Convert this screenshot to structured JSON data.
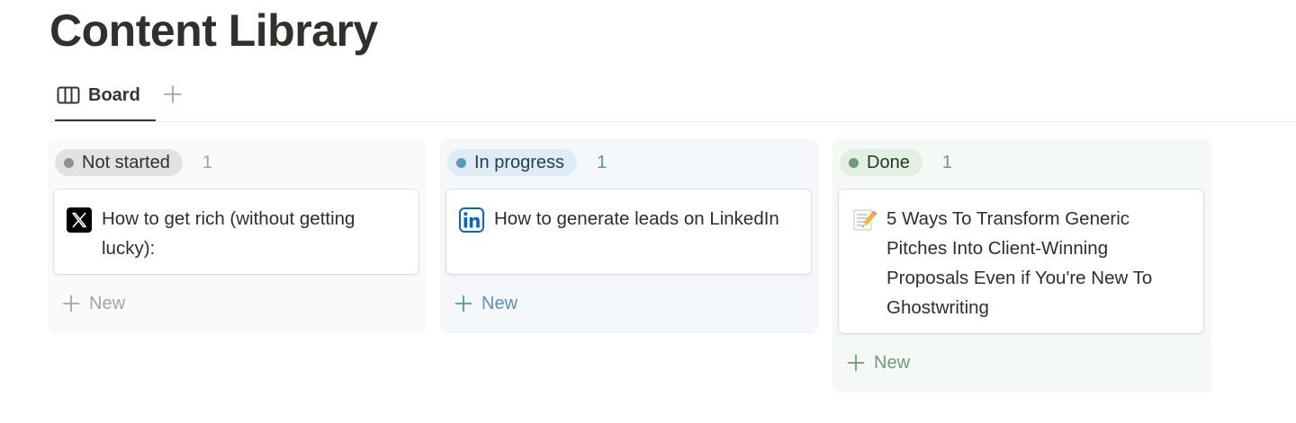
{
  "page": {
    "title": "Content Library"
  },
  "views": {
    "active_tab": {
      "label": "Board",
      "icon": "board-columns-icon"
    },
    "add_view_icon": "plus-icon"
  },
  "columns": [
    {
      "status": "Not started",
      "count": "1",
      "colors": {
        "column_bg": "#fafaf9",
        "pill_bg": "#e3e2e0",
        "dot": "#91918e",
        "text": "#32302c",
        "count": "#a5a4a0",
        "new": "#a5a4a0"
      },
      "cards": [
        {
          "icon": "x-logo-icon",
          "title": "How to get rich (without getting lucky):"
        }
      ],
      "new_label": "New"
    },
    {
      "status": "In progress",
      "count": "1",
      "colors": {
        "column_bg": "#f4f8fb",
        "pill_bg": "#dfebf5",
        "dot": "#5b97bd",
        "text": "#1f3d56",
        "count": "#5b8fbd",
        "new": "#5b8fbd"
      },
      "cards": [
        {
          "icon": "linkedin-logo-icon",
          "title": "How to generate leads on LinkedIn"
        }
      ],
      "new_label": "New"
    },
    {
      "status": "Done",
      "count": "1",
      "colors": {
        "column_bg": "#f5f9f5",
        "pill_bg": "#e4efe4",
        "dot": "#6c9b7d",
        "text": "#1f3a26",
        "count": "#6c9b7d",
        "new": "#6c9b7d"
      },
      "cards": [
        {
          "icon": "memo-pencil-icon",
          "title": "5 Ways To Transform Generic Pitches Into Client-Winning Proposals Even if You're New To Ghostwriting"
        }
      ],
      "new_label": "New"
    }
  ]
}
